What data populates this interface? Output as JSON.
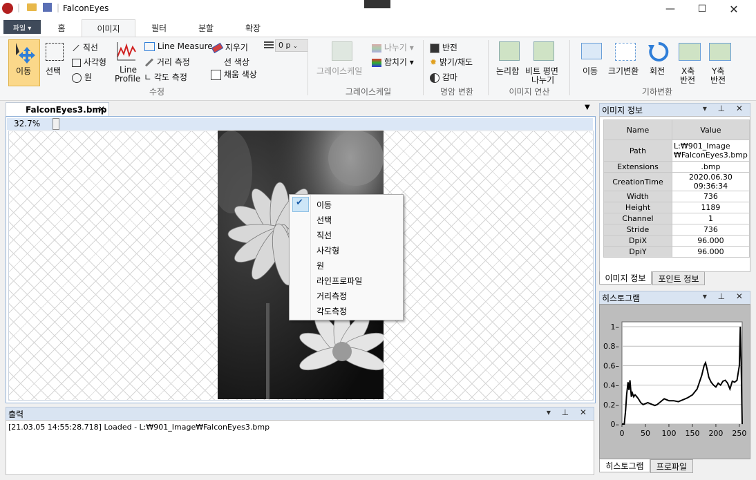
{
  "app": {
    "title": "FalconEyes"
  },
  "ribbon_tabs": {
    "file": "파일 ▾",
    "home": "홈",
    "image": "이미지",
    "filter": "필터",
    "split": "분할",
    "extend": "확장"
  },
  "ribbon": {
    "move": "이동",
    "select": "선택",
    "line": "직선",
    "rect": "사각형",
    "circle": "원",
    "line_profile_1": "Line",
    "line_profile_2": "Profile",
    "line_measure": "Line Measure",
    "distance": "거리 측정",
    "angle": "각도 측정",
    "eraser": "지우기",
    "line_color": "선 색상",
    "fill_color": "채움 색상",
    "thickness": "0 p",
    "group_edit": "수정",
    "grayscale": "그레이스케일",
    "divide": "나누기",
    "merge": "합치기",
    "group_gray": "그레이스케일",
    "invert": "반전",
    "brightness": "밝기/채도",
    "gamma": "감마",
    "group_contrast": "명암 변환",
    "logic_sum": "논리합",
    "bitplane_1": "비트 평면",
    "bitplane_2": "나누기",
    "group_image_op": "이미지 연산",
    "geo_move": "이동",
    "resize": "크기변환",
    "rotate": "회전",
    "xflip_1": "X축",
    "xflip_2": "반전",
    "yflip_1": "Y축",
    "yflip_2": "반전",
    "group_geo": "기하변환"
  },
  "document": {
    "tab": "FalconEyes3.bmp",
    "zoom": "32.7%"
  },
  "context_menu": {
    "items": [
      "이동",
      "선택",
      "직선",
      "사각형",
      "원",
      "라인프로파일",
      "거리측정",
      "각도측정"
    ],
    "checked_index": 0
  },
  "output": {
    "title": "출력",
    "log": "[21.03.05 14:55:28.718] Loaded - L:₩901_Image₩FalconEyes3.bmp"
  },
  "image_info": {
    "title": "이미지 정보",
    "col_name": "Name",
    "col_value": "Value",
    "rows": [
      {
        "k": "Path",
        "v1": "L:₩901_Image",
        "v2": "₩FalconEyes3.bmp"
      },
      {
        "k": "Extensions",
        "v1": ".bmp"
      },
      {
        "k": "CreationTime",
        "v1": "2020.06.30 09:36:34"
      },
      {
        "k": "Width",
        "v1": "736"
      },
      {
        "k": "Height",
        "v1": "1189"
      },
      {
        "k": "Channel",
        "v1": "1"
      },
      {
        "k": "Stride",
        "v1": "736"
      },
      {
        "k": "DpiX",
        "v1": "96.000"
      },
      {
        "k": "DpiY",
        "v1": "96.000"
      }
    ],
    "tab_image": "이미지 정보",
    "tab_point": "포인트 정보"
  },
  "histogram": {
    "title": "히스토그램",
    "tab_hist": "히스토그램",
    "tab_profile": "프로파일",
    "y_ticks": [
      "1",
      "0.8",
      "0.6",
      "0.4",
      "0.2",
      "0"
    ],
    "x_ticks": [
      "0",
      "50",
      "100",
      "150",
      "200",
      "250"
    ],
    "chart_data": {
      "type": "line",
      "x": [
        0,
        5,
        8,
        10,
        13,
        15,
        17,
        20,
        22,
        25,
        28,
        30,
        35,
        40,
        45,
        50,
        55,
        60,
        65,
        70,
        75,
        80,
        90,
        100,
        110,
        120,
        130,
        140,
        150,
        160,
        170,
        175,
        178,
        182,
        185,
        190,
        195,
        200,
        205,
        210,
        215,
        220,
        225,
        230,
        235,
        240,
        245,
        250,
        252,
        254,
        256
      ],
      "y": [
        0,
        0,
        0.15,
        0.3,
        0.43,
        0.35,
        0.45,
        0.28,
        0.32,
        0.28,
        0.3,
        0.29,
        0.26,
        0.22,
        0.2,
        0.21,
        0.22,
        0.21,
        0.2,
        0.19,
        0.2,
        0.22,
        0.26,
        0.24,
        0.24,
        0.23,
        0.25,
        0.27,
        0.3,
        0.36,
        0.5,
        0.6,
        0.63,
        0.55,
        0.48,
        0.43,
        0.4,
        0.38,
        0.42,
        0.4,
        0.44,
        0.45,
        0.42,
        0.36,
        0.44,
        0.43,
        0.45,
        0.6,
        1.0,
        0.6,
        0
      ],
      "ylim": [
        0,
        1.05
      ],
      "xlim": [
        0,
        256
      ],
      "grid": true
    }
  }
}
